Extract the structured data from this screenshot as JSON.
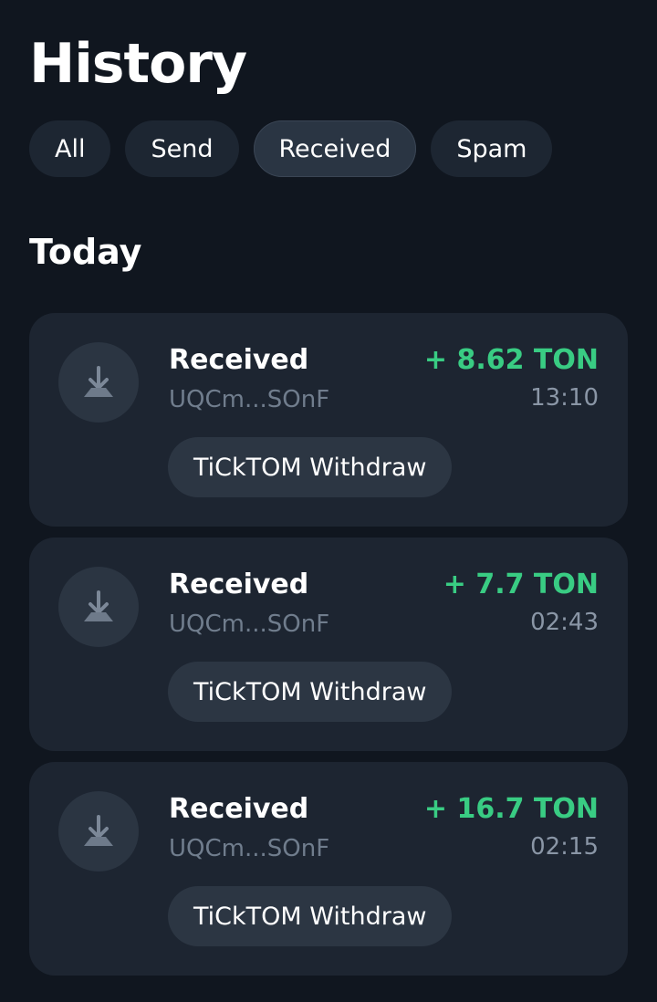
{
  "header": {
    "title": "History"
  },
  "filters": [
    {
      "label": "All",
      "active": false
    },
    {
      "label": "Send",
      "active": false
    },
    {
      "label": "Received",
      "active": true
    },
    {
      "label": "Spam",
      "active": false
    }
  ],
  "section": {
    "title": "Today"
  },
  "transactions": [
    {
      "icon": "receive-arrow-icon",
      "type": "Received",
      "address": "UQCm...SOnF",
      "amount": "+ 8.62 TON",
      "time": "13:10",
      "comment": "TiCkTOM Withdraw"
    },
    {
      "icon": "receive-arrow-icon",
      "type": "Received",
      "address": "UQCm...SOnF",
      "amount": "+ 7.7 TON",
      "time": "02:43",
      "comment": "TiCkTOM Withdraw"
    },
    {
      "icon": "receive-arrow-icon",
      "type": "Received",
      "address": "UQCm...SOnF",
      "amount": "+ 16.7 TON",
      "time": "02:15",
      "comment": "TiCkTOM Withdraw"
    }
  ],
  "colors": {
    "background": "#10161F",
    "card": "#1D2531",
    "positive_amount": "#39CC83",
    "secondary_text": "#707D8D"
  }
}
